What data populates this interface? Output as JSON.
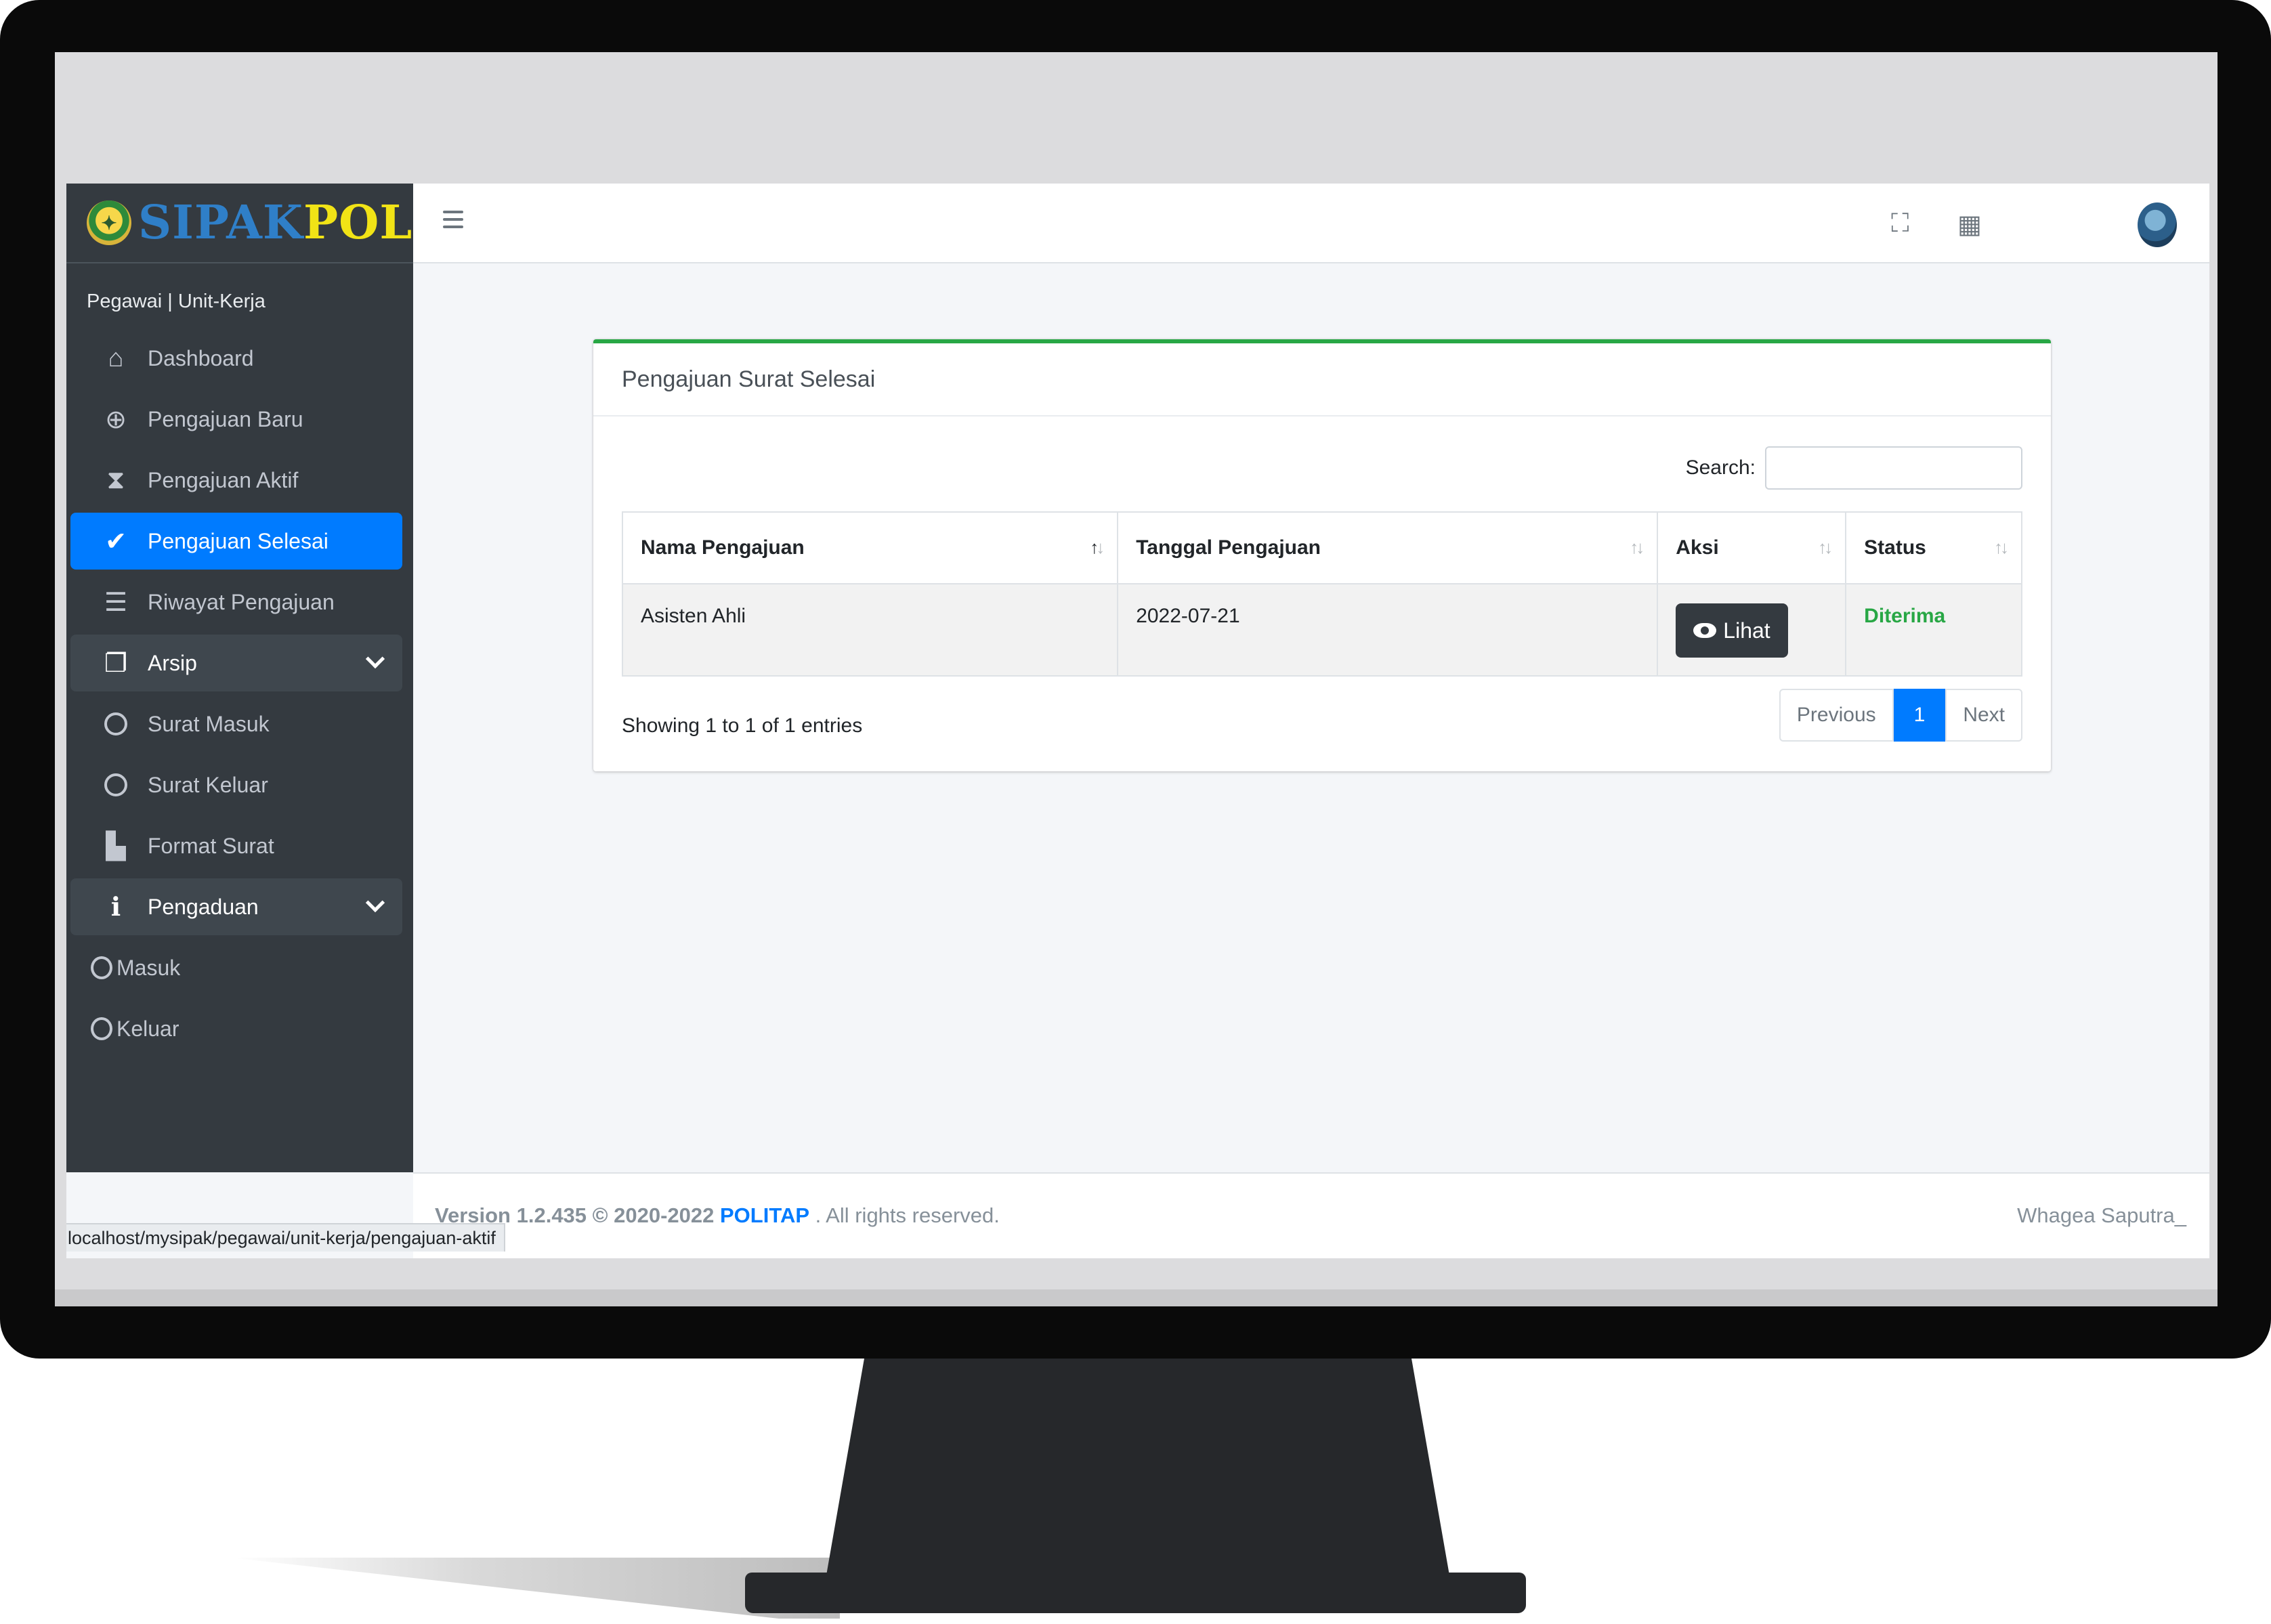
{
  "brand": {
    "part1": "SIPAK",
    "part2": "POL",
    "logo_icon": "emblem-logo"
  },
  "user_panel": {
    "text": "Pegawai | Unit-Kerja"
  },
  "sidebar": {
    "items": [
      {
        "label": "Dashboard",
        "icon": "home-icon"
      },
      {
        "label": "Pengajuan Baru",
        "icon": "plus-circle-icon"
      },
      {
        "label": "Pengajuan Aktif",
        "icon": "hourglass-icon"
      },
      {
        "label": "Pengajuan Selesai",
        "icon": "check-icon",
        "active": true
      },
      {
        "label": "Riwayat Pengajuan",
        "icon": "list-icon"
      },
      {
        "label": "Arsip",
        "icon": "copy-icon",
        "expandable": true
      },
      {
        "label": "Surat Masuk",
        "icon": "circle-icon"
      },
      {
        "label": "Surat Keluar",
        "icon": "circle-icon"
      },
      {
        "label": "Format Surat",
        "icon": "file-icon"
      },
      {
        "label": "Pengaduan",
        "icon": "info-icon",
        "expandable": true
      },
      {
        "label": "Masuk",
        "icon": "circle-icon"
      },
      {
        "label": "Keluar",
        "icon": "circle-icon"
      }
    ]
  },
  "topbar": {
    "icons": [
      "menu-icon",
      "fullscreen-icon",
      "apps-grid-icon",
      "user-avatar"
    ]
  },
  "card": {
    "title": "Pengajuan Surat Selesai",
    "search_label": "Search:",
    "search_value": "",
    "columns": [
      "Nama Pengajuan",
      "Tanggal Pengajuan",
      "Aksi",
      "Status"
    ],
    "rows": [
      {
        "nama": "Asisten Ahli",
        "tanggal": "2022-07-21",
        "aksi": "Lihat",
        "status": "Diterima"
      }
    ],
    "info": "Showing 1 to 1 of 1 entries",
    "pager": {
      "previous": "Previous",
      "current": "1",
      "next": "Next"
    }
  },
  "footer": {
    "version": "Version 1.2.435 © 2020-2022",
    "link": "POLITAP",
    "rights": ". All rights reserved.",
    "author": "Whagea Saputra_"
  },
  "status_bar": {
    "url": "localhost/mysipak/pegawai/unit-kerja/pengajuan-aktif"
  },
  "colors": {
    "accent": "#007bff",
    "sidebar": "#343a40",
    "success": "#28a745",
    "brand_yellow": "#f1e316",
    "brand_blue": "#2f7fc8"
  }
}
